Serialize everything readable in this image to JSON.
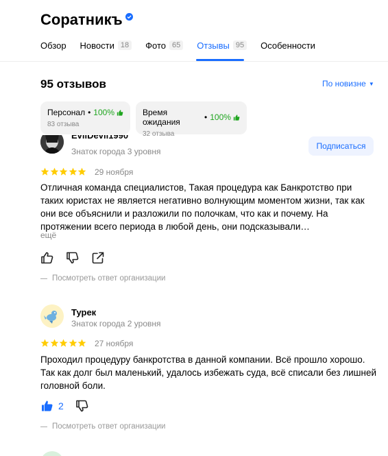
{
  "header": {
    "title": "Соратникъ",
    "tabs": [
      {
        "label": "Обзор",
        "count": ""
      },
      {
        "label": "Новости",
        "count": "18"
      },
      {
        "label": "Фото",
        "count": "65"
      },
      {
        "label": "Отзывы",
        "count": "95"
      },
      {
        "label": "Особенности",
        "count": ""
      }
    ],
    "active_tab": "Отзывы",
    "accent_color": "#196dff"
  },
  "summary": {
    "title": "95 отзывов",
    "sort_label": "По новизне"
  },
  "aspects": [
    {
      "name": "Персонал",
      "percent": "100%",
      "reviews": "83 отзыва"
    },
    {
      "name": "Время ожидания",
      "percent": "100%",
      "reviews": "32 отзыва"
    }
  ],
  "reviews": [
    {
      "author": "EvilDevil1990",
      "level": "Знаток города 3 уровня",
      "rating": 5,
      "date": "29 ноября",
      "text": "Отличная команда специалистов, Такая процедура как Банкротство при таких юристах не является негативно волнующим моментом жизни, так как они все объяснили и разложили по полочкам, что как и почему. На протяжении всего периода в любой день, они подсказывали…",
      "more_label": "ещё",
      "subscribe_label": "Подписаться",
      "org_answer_label": "Посмотреть ответ организации"
    },
    {
      "author": "Турек",
      "level": "Знаток города 2 уровня",
      "rating": 5,
      "date": "27 ноября",
      "text": "Проходил процедуру банкротства в данной компании. Всё прошло хорошо. Так как долг был маленький, удалось избежать суда, всё списали без лишней головной боли.",
      "likes": "2",
      "org_answer_label": "Посмотреть ответ организации"
    }
  ]
}
